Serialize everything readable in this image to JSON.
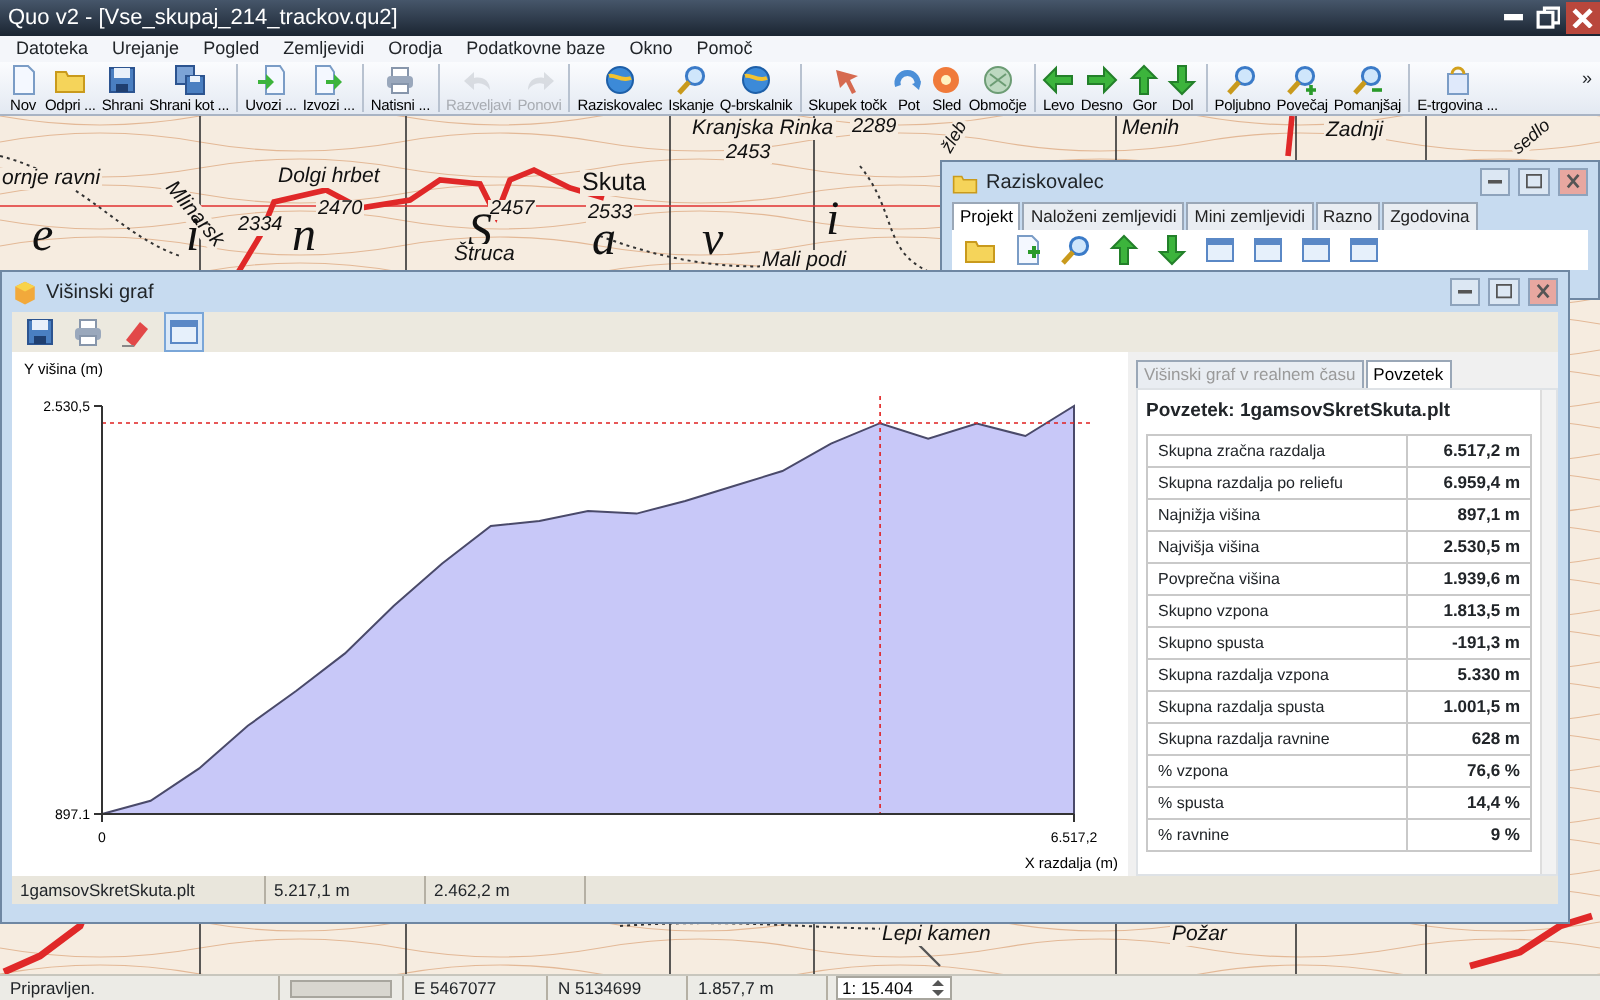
{
  "window": {
    "title": "Quo v2 - [Vse_skupaj_214_trackov.qu2]"
  },
  "menu": [
    "Datoteka",
    "Urejanje",
    "Pogled",
    "Zemljevidi",
    "Orodja",
    "Podatkovne baze",
    "Okno",
    "Pomoč"
  ],
  "toolbar": [
    [
      {
        "label": "Nov",
        "disabled": false
      },
      {
        "label": "Odpri ...",
        "disabled": false
      },
      {
        "label": "Shrani",
        "disabled": false
      },
      {
        "label": "Shrani kot ...",
        "disabled": false
      }
    ],
    [
      {
        "label": "Uvozi ...",
        "disabled": false
      },
      {
        "label": "Izvozi ...",
        "disabled": false
      }
    ],
    [
      {
        "label": "Natisni ...",
        "disabled": false
      }
    ],
    [
      {
        "label": "Razveljavi",
        "disabled": true
      },
      {
        "label": "Ponovi",
        "disabled": true
      }
    ],
    [
      {
        "label": "Raziskovalec",
        "disabled": false
      },
      {
        "label": "Iskanje",
        "disabled": false
      },
      {
        "label": "Q-brskalnik",
        "disabled": false
      }
    ],
    [
      {
        "label": "Skupek točk",
        "disabled": false
      },
      {
        "label": "Pot",
        "disabled": false
      },
      {
        "label": "Sled",
        "disabled": false
      },
      {
        "label": "Območje",
        "disabled": false
      }
    ],
    [
      {
        "label": "Levo",
        "disabled": false
      },
      {
        "label": "Desno",
        "disabled": false
      },
      {
        "label": "Gor",
        "disabled": false
      },
      {
        "label": "Dol",
        "disabled": false
      }
    ],
    [
      {
        "label": "Poljubno",
        "disabled": false
      },
      {
        "label": "Povečaj",
        "disabled": false
      },
      {
        "label": "Pomanjšaj",
        "disabled": false
      }
    ],
    [
      {
        "label": "E-trgovina ...",
        "disabled": false
      }
    ]
  ],
  "toolbar_overflow": "»",
  "map": {
    "labels": [
      {
        "text": "Kranjska Rinka",
        "kind": "name"
      },
      {
        "text": "2289",
        "kind": "height"
      },
      {
        "text": "2453",
        "kind": "height"
      },
      {
        "text": "Menih",
        "kind": "name"
      },
      {
        "text": "Zadnji",
        "kind": "name"
      },
      {
        "text": "sedlo",
        "kind": "name"
      },
      {
        "text": "žleb",
        "kind": "name"
      },
      {
        "text": "ornje ravni",
        "kind": "name"
      },
      {
        "text": "Dolgi hrbet",
        "kind": "name"
      },
      {
        "text": "Mlinarsk",
        "kind": "name"
      },
      {
        "text": "2470",
        "kind": "height"
      },
      {
        "text": "2334",
        "kind": "height"
      },
      {
        "text": "2457",
        "kind": "height"
      },
      {
        "text": "Skuta",
        "kind": "peak"
      },
      {
        "text": "2533",
        "kind": "height"
      },
      {
        "text": "e",
        "kind": "letter"
      },
      {
        "text": "i",
        "kind": "letter"
      },
      {
        "text": "n",
        "kind": "letter"
      },
      {
        "text": "S",
        "kind": "letter"
      },
      {
        "text": "a",
        "kind": "letter"
      },
      {
        "text": "v",
        "kind": "letter"
      },
      {
        "text": "i",
        "kind": "letter"
      },
      {
        "text": "Štruca",
        "kind": "name"
      },
      {
        "text": "Mali podi",
        "kind": "name"
      },
      {
        "text": "Lepi kamen",
        "kind": "name"
      },
      {
        "text": "Požar",
        "kind": "name"
      }
    ]
  },
  "explorer": {
    "title": "Raziskovalec",
    "tabs": [
      {
        "label": "Projekt",
        "selected": true
      },
      {
        "label": "Naloženi zemljevidi",
        "selected": false
      },
      {
        "label": "Mini zemljevidi",
        "selected": false
      },
      {
        "label": "Razno",
        "selected": false
      },
      {
        "label": "Zgodovina",
        "selected": false
      }
    ]
  },
  "graph_window": {
    "title": "Višinski graf",
    "chart_data": {
      "type": "area",
      "xlabel": "X razdalja (m)",
      "ylabel": "Y višina (m)",
      "x": [
        0,
        325.9,
        651.7,
        977.6,
        1303.4,
        1629.3,
        1955.2,
        2281,
        2606.9,
        2932.7,
        3258.6,
        3584.5,
        3910.3,
        4236.2,
        4562,
        4887.9,
        5217.1,
        5539.6,
        5865.5,
        6191.3,
        6517.2
      ],
      "series": [
        {
          "color": "#c8c8f8",
          "values": [
            897.1,
            950,
            1080,
            1250,
            1390,
            1540,
            1730,
            1900,
            2050,
            2070,
            2110,
            2100,
            2150,
            2210,
            2270,
            2380,
            2462,
            2400,
            2460,
            2410,
            2530.5
          ]
        }
      ],
      "xlim": [
        0,
        6517.2
      ],
      "ylim": [
        897.1,
        2530.5
      ],
      "xticks": [
        0,
        {
          "value": 6517.2,
          "label": "6.517,2"
        }
      ],
      "yticks": [
        {
          "value": 897.1,
          "label": "897.1"
        },
        {
          "value": 2530.5,
          "label": "2.530,5"
        }
      ],
      "ref_lines": [
        {
          "axis": "x",
          "value": 5217.1
        },
        {
          "axis": "y",
          "value": 2462.2
        }
      ]
    },
    "side_tabs": [
      {
        "label": "Višinski graf v realnem času",
        "selected": false
      },
      {
        "label": "Povzetek",
        "selected": true
      }
    ],
    "summary": {
      "title": "Povzetek: 1gamsovSkretSkuta.plt",
      "rows": [
        {
          "label": "Skupna zračna razdalja",
          "value": "6.517,2 m"
        },
        {
          "label": "Skupna razdalja po reliefu",
          "value": "6.959,4 m"
        },
        {
          "label": "Najnižja višina",
          "value": "897,1 m"
        },
        {
          "label": "Najvišja višina",
          "value": "2.530,5 m"
        },
        {
          "label": "Povprečna višina",
          "value": "1.939,6 m"
        },
        {
          "label": "Skupno vzpona",
          "value": "1.813,5 m"
        },
        {
          "label": "Skupno spusta",
          "value": "-191,3 m"
        },
        {
          "label": "Skupna razdalja vzpona",
          "value": "5.330 m"
        },
        {
          "label": "Skupna razdalja spusta",
          "value": "1.001,5 m"
        },
        {
          "label": "Skupna razdalja ravnine",
          "value": "628 m"
        },
        {
          "label": "% vzpona",
          "value": "76,6 %"
        },
        {
          "label": "% spusta",
          "value": "14,4 %"
        },
        {
          "label": "% ravnine",
          "value": "9 %"
        }
      ]
    },
    "footer": [
      "1gamsovSkretSkuta.plt",
      "5.217,1 m",
      "2.462,2 m"
    ]
  },
  "status_bar": {
    "message": "Pripravljen.",
    "progress": {
      "level": 0
    },
    "easting": "E 5467077",
    "northing": "N 5134699",
    "distance": "1.857,7 m",
    "scale": "1: 15.404"
  }
}
